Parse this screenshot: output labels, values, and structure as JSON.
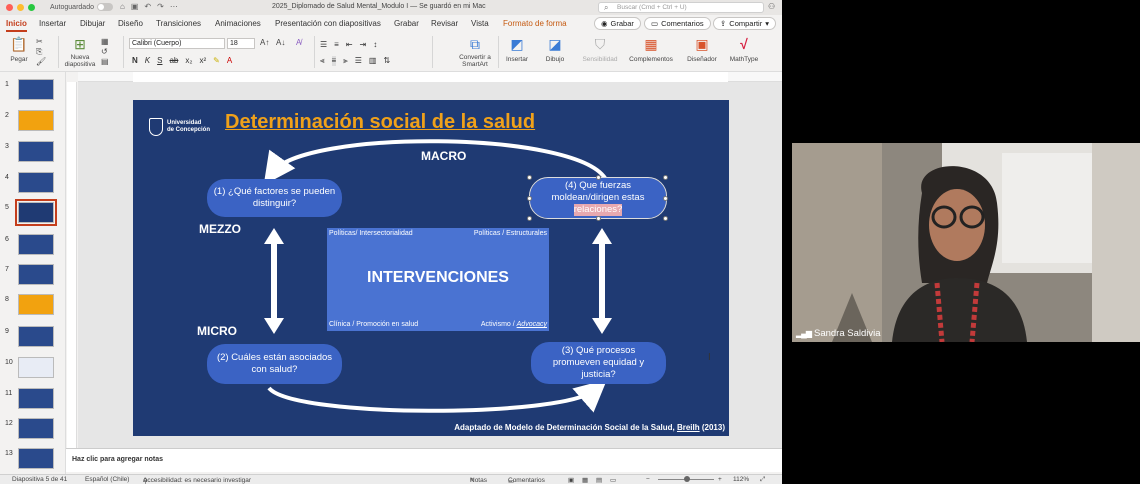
{
  "window": {
    "autosave_label": "Autoguardado",
    "doc_title": "2025_Diplomado de Salud Mental_Modulo I — Se guardó en mi Mac",
    "search_placeholder": "Buscar (Cmd + Ctrl + U)"
  },
  "tabs": [
    "Inicio",
    "Insertar",
    "Dibujar",
    "Diseño",
    "Transiciones",
    "Animaciones",
    "Presentación con diapositivas",
    "Grabar",
    "Revisar",
    "Vista",
    "Formato de forma"
  ],
  "tab_actions": {
    "record": "Grabar",
    "comments": "Comentarios",
    "share": "Compartir"
  },
  "ribbon": {
    "paste": "Pegar",
    "new_slide": "Nueva diapositiva",
    "font_name": "Calibri (Cuerpo)",
    "font_size": "18",
    "smartart": "Convertir a SmartArt",
    "insert": "Insertar",
    "draw": "Dibujo",
    "sensitivity": "Sensibilidad",
    "addins": "Complementos",
    "designer": "Diseñador",
    "mathtype": "MathType"
  },
  "thumbnails": {
    "numbers": [
      "1",
      "2",
      "3",
      "4",
      "5",
      "6",
      "7",
      "8",
      "9",
      "10",
      "11",
      "12",
      "13"
    ],
    "selected": "5"
  },
  "slide": {
    "logo_line1": "Universidad",
    "logo_line2": "de Concepción",
    "title": "Determinación social de la salud",
    "macro": "MACRO",
    "mezzo": "MEZZO",
    "micro": "MICRO",
    "q1": "(1) ¿Qué factores se pueden distinguir?",
    "q2": "(2) Cuáles están asociados con salud?",
    "q3": "(3) Qué procesos promueven equidad y justicia?",
    "q4_a": "(4) Que fuerzas moldean/dirigen estas",
    "q4_b": "relaciones?",
    "center_title": "INTERVENCIONES",
    "tl": "Políticas/ Intersectorialidad",
    "tr": "Políticas / Estructurales",
    "bl": "Clínica / Promoción en salud",
    "br_a": "Activismo / ",
    "br_b": "Advocacy",
    "credit_a": "Adaptado de Modelo de Determinación Social de la Salud,  ",
    "credit_b": "Breilh",
    "credit_c": " (2013)"
  },
  "notes_placeholder": "Haz clic para agregar notas",
  "status": {
    "slide_of": "Diapositiva 5 de 41",
    "language": "Español (Chile)",
    "accessibility": "Accesibilidad: es necesario investigar",
    "notes": "Notas",
    "comments": "Comentarios",
    "zoom": "112%"
  },
  "webcam": {
    "participant": "Sandra Saldivia"
  },
  "colors": {
    "slide_bg": "#1f3a73",
    "oval": "#3b63c4",
    "title": "#f0a11a",
    "accent": "#c43e1c"
  }
}
